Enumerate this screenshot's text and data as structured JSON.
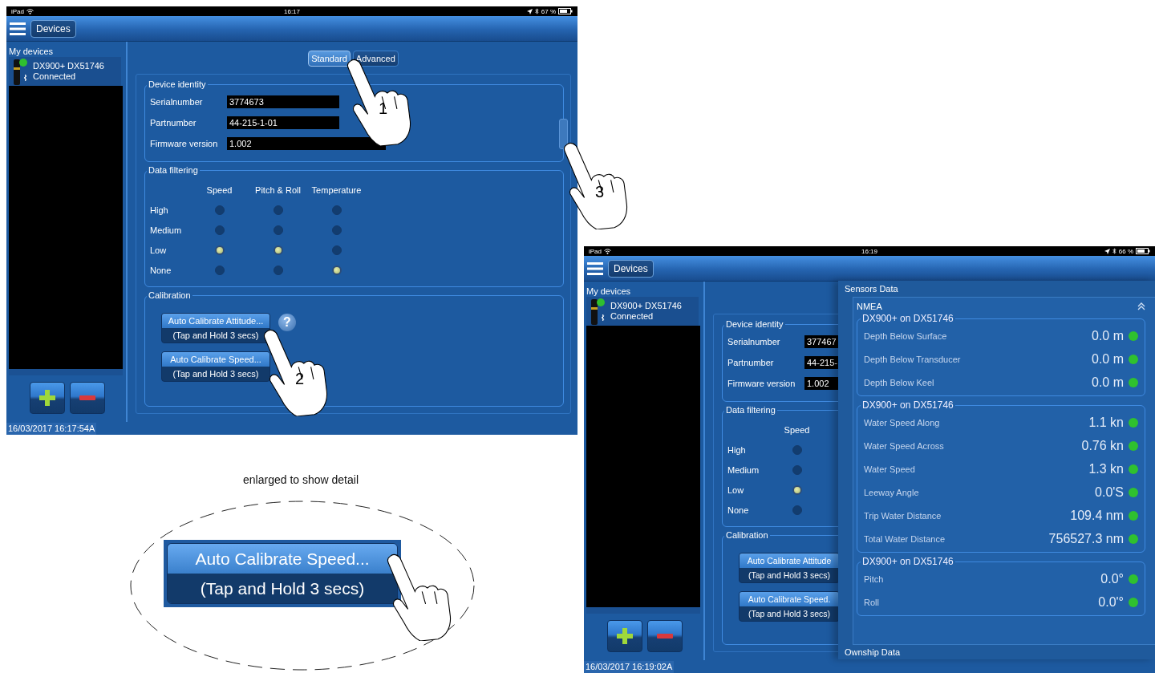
{
  "screens": [
    {
      "status_bar": {
        "carrier": "iPad",
        "time": "16:17",
        "battery": "67 %"
      },
      "nav_button": "Devices",
      "sidebar": {
        "title": "My devices",
        "devices": [
          {
            "name": "DX900+ DX51746",
            "status": "Connected",
            "connected": true
          }
        ]
      },
      "tabs": [
        {
          "label": "Standard",
          "selected": true
        },
        {
          "label": "Advanced",
          "selected": false
        }
      ],
      "device_identity": {
        "title": "Device identity",
        "fields": [
          {
            "label": "Serialnumber",
            "value": "3774673"
          },
          {
            "label": "Partnumber",
            "value": "44-215-1-01"
          },
          {
            "label": "Firmware version",
            "value": "1.002"
          }
        ]
      },
      "data_filtering": {
        "title": "Data filtering",
        "columns": [
          "Speed",
          "Pitch & Roll",
          "Temperature"
        ],
        "rows": [
          {
            "label": "High",
            "options": [
              {
                "selected": false
              },
              {
                "selected": false
              },
              {
                "selected": false
              }
            ]
          },
          {
            "label": "Medium",
            "options": [
              {
                "selected": false
              },
              {
                "selected": false
              },
              {
                "selected": false
              }
            ]
          },
          {
            "label": "Low",
            "options": [
              {
                "selected": true
              },
              {
                "selected": true
              },
              {
                "selected": false
              }
            ]
          },
          {
            "label": "None",
            "options": [
              {
                "selected": false
              },
              {
                "selected": false
              },
              {
                "selected": true
              }
            ]
          }
        ]
      },
      "calibration": {
        "title": "Calibration",
        "buttons": [
          {
            "label": "Auto Calibrate Attitude...",
            "hint": "(Tap and Hold 3 secs)"
          },
          {
            "label": "Auto Calibrate Speed...",
            "hint": "(Tap and Hold 3 secs)"
          }
        ],
        "help": "?"
      },
      "timestamp": "16/03/2017 16:17:54A"
    },
    {
      "status_bar": {
        "carrier": "iPad",
        "time": "16:19",
        "battery": "66 %"
      },
      "nav_button": "Devices",
      "sidebar": {
        "title": "My devices",
        "devices": [
          {
            "name": "DX900+ DX51746",
            "status": "Connected",
            "connected": true
          }
        ]
      },
      "device_identity": {
        "title": "Device identity",
        "fields": [
          {
            "label": "Serialnumber",
            "value": "377467"
          },
          {
            "label": "Partnumber",
            "value": "44-215-"
          },
          {
            "label": "Firmware version",
            "value": "1.002"
          }
        ]
      },
      "data_filtering": {
        "title": "Data filtering",
        "columns": [
          "Speed"
        ],
        "rows": [
          {
            "label": "High",
            "options": [
              {
                "selected": false
              }
            ]
          },
          {
            "label": "Medium",
            "options": [
              {
                "selected": false
              }
            ]
          },
          {
            "label": "Low",
            "options": [
              {
                "selected": true
              }
            ]
          },
          {
            "label": "None",
            "options": [
              {
                "selected": false
              }
            ]
          }
        ]
      },
      "calibration": {
        "title": "Calibration",
        "buttons": [
          {
            "label": "Auto Calibrate Attitude",
            "hint": "(Tap and Hold 3 secs)"
          },
          {
            "label": "Auto Calibrate Speed.",
            "hint": "(Tap and Hold 3 secs)"
          }
        ]
      },
      "sensors_panel": {
        "title": "Sensors Data",
        "section": {
          "title": "NMEA",
          "expanded": true
        },
        "groups": [
          {
            "title": "DX900+ on DX51746",
            "readings": [
              {
                "label": "Depth Below Surface",
                "value": "0.0 m",
                "ok": true
              },
              {
                "label": "Depth Below Transducer",
                "value": "0.0 m",
                "ok": true
              },
              {
                "label": "Depth Below Keel",
                "value": "0.0 m",
                "ok": true
              }
            ]
          },
          {
            "title": "DX900+ on DX51746",
            "readings": [
              {
                "label": "Water Speed Along",
                "value": "1.1 kn",
                "ok": true
              },
              {
                "label": "Water Speed Across",
                "value": "0.76 kn",
                "ok": true
              },
              {
                "label": "Water Speed",
                "value": "1.3 kn",
                "ok": true
              },
              {
                "label": "Leeway Angle",
                "value": "0.0'S",
                "ok": true
              },
              {
                "label": "Trip Water Distance",
                "value": "109.4 nm",
                "ok": true
              },
              {
                "label": "Total Water Distance",
                "value": "756527.3 nm",
                "ok": true
              }
            ]
          },
          {
            "title": "DX900+ on DX51746",
            "readings": [
              {
                "label": "Pitch",
                "value": "0.0°",
                "ok": true
              },
              {
                "label": "Roll",
                "value": "0.0'°",
                "ok": true
              }
            ]
          }
        ],
        "footer": "Ownship Data"
      },
      "timestamp": "16/03/2017 16:19:02A"
    }
  ],
  "annotations": [
    "1",
    "2",
    "3"
  ],
  "detail": {
    "caption": "enlarged to show detail",
    "button": {
      "label": "Auto Calibrate Speed...",
      "hint": "(Tap and Hold 3 secs)"
    }
  }
}
